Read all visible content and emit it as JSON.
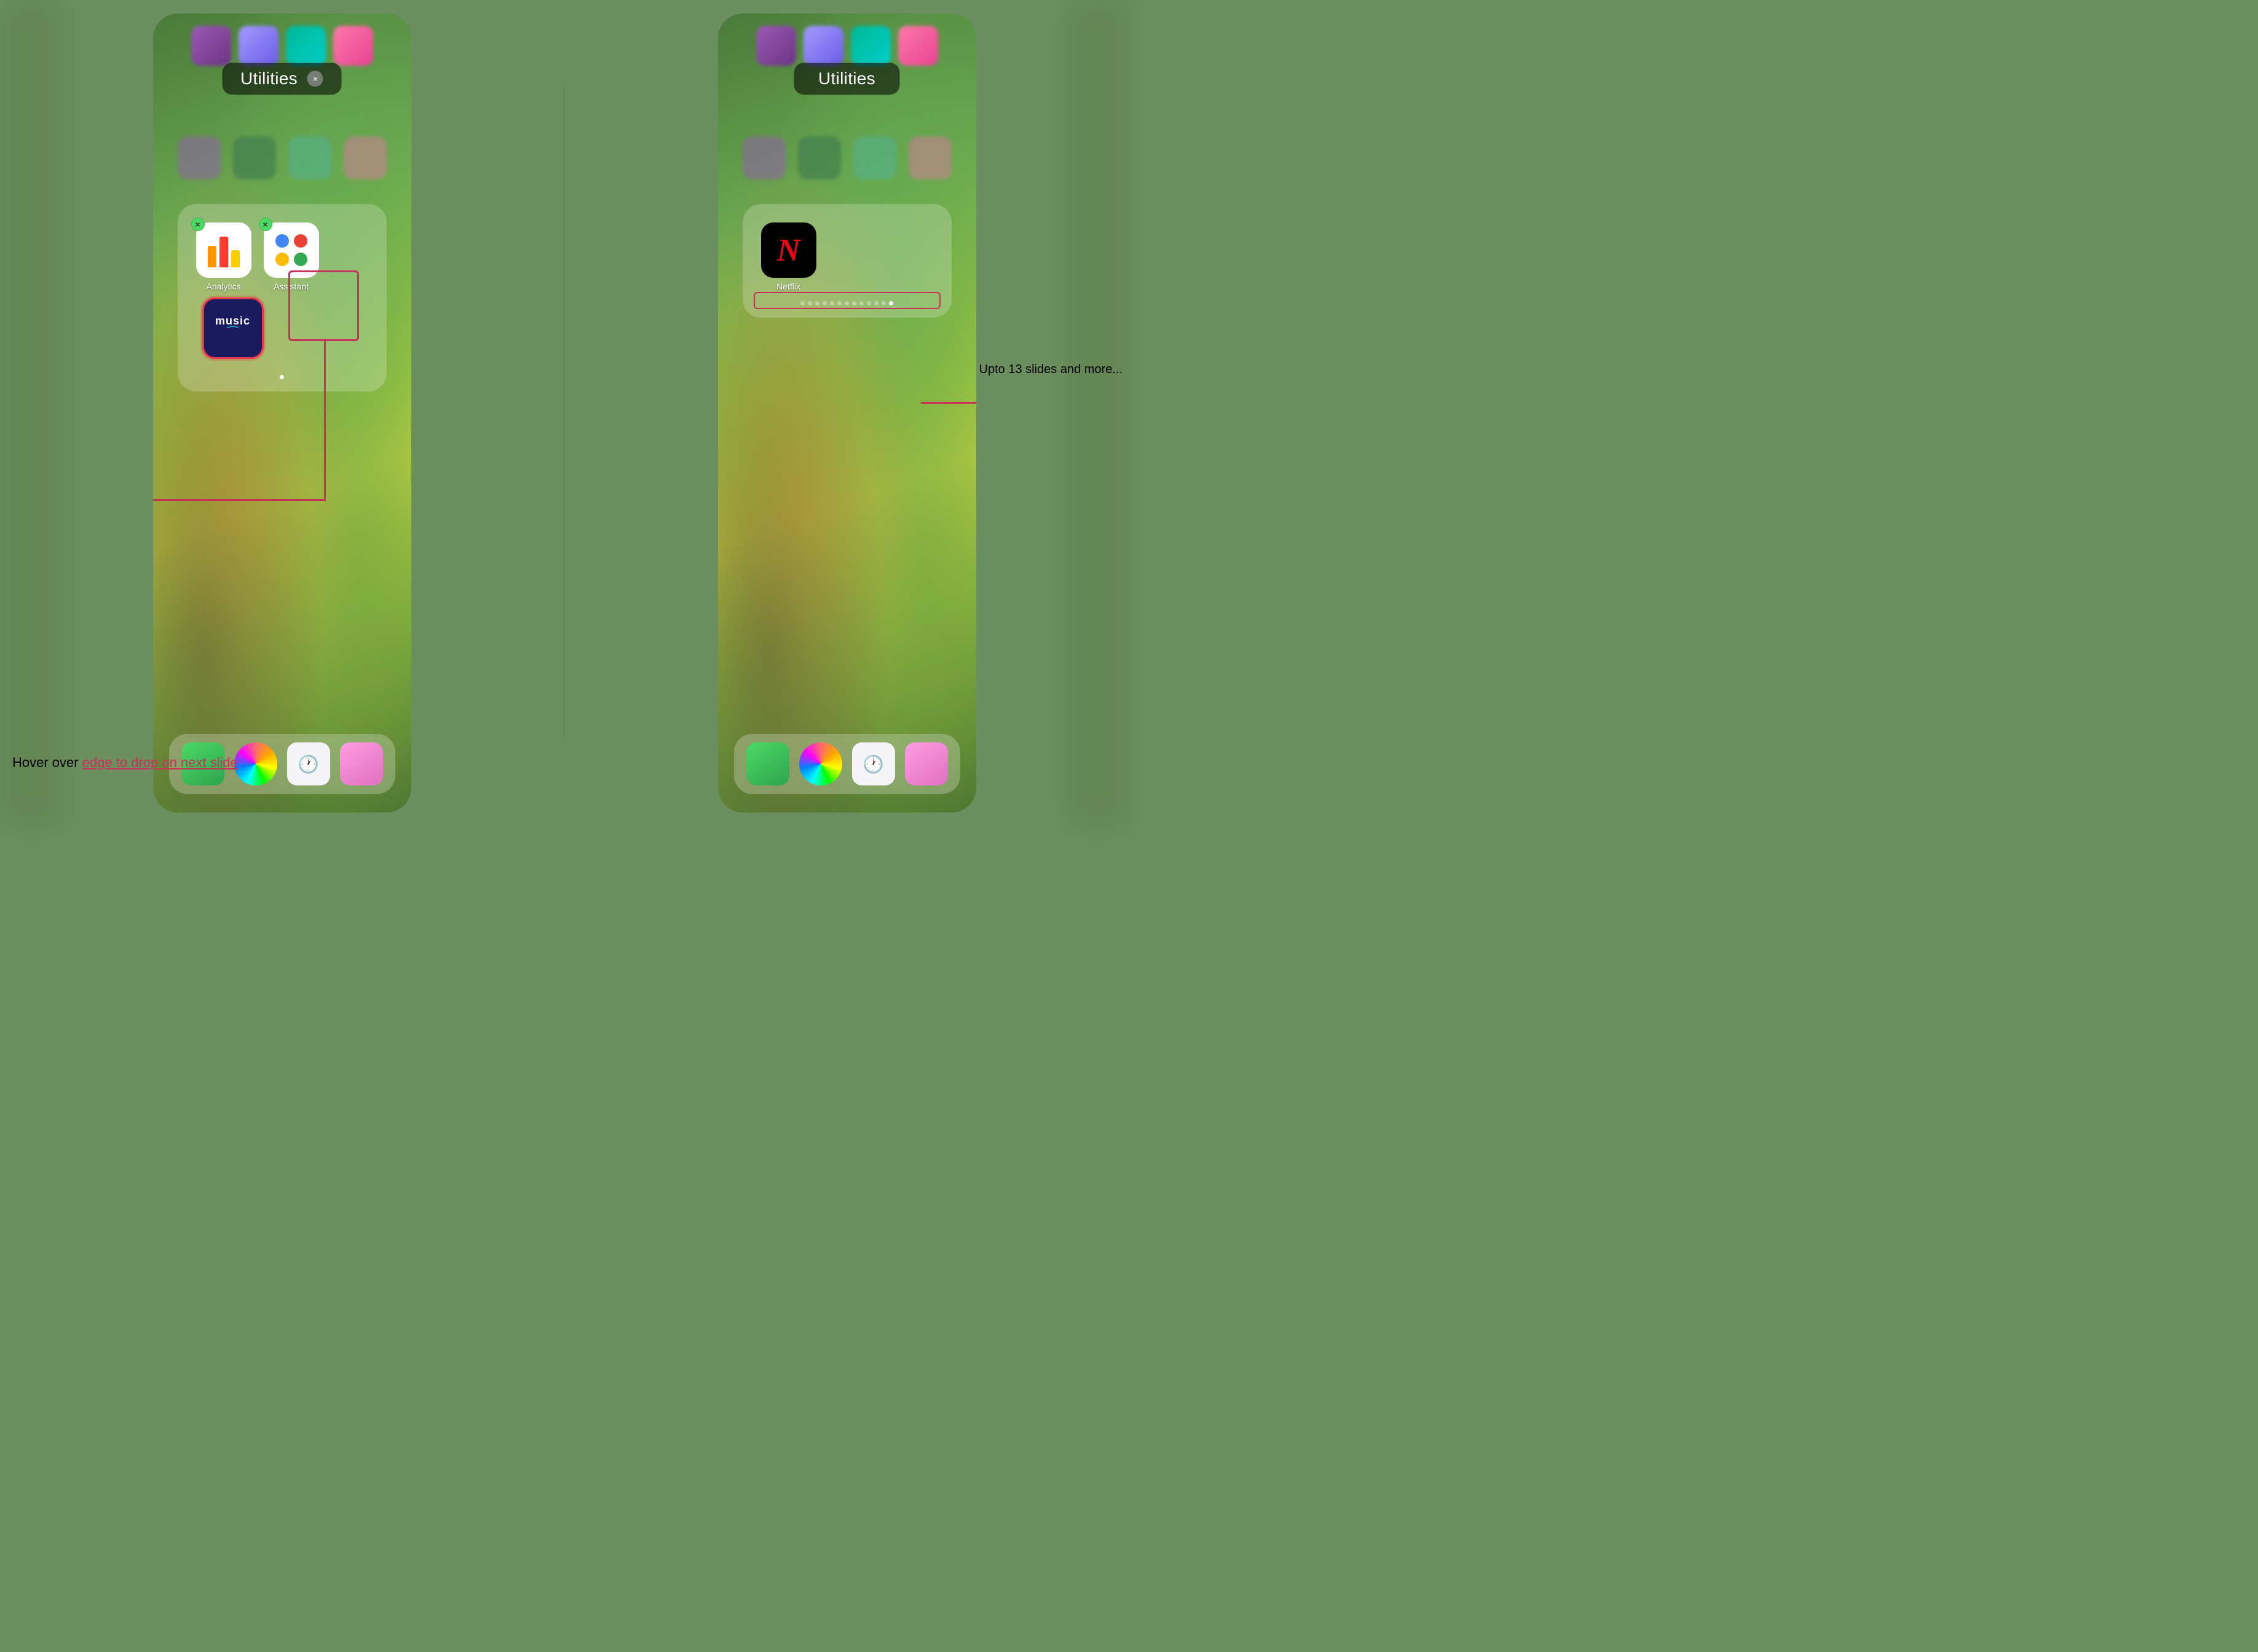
{
  "page": {
    "background_color": "#6b8f5e",
    "divider_color": "rgba(100,100,100,0.3)"
  },
  "left_phone": {
    "utilities_title": "Utilities",
    "close_button_label": "×",
    "folder": {
      "apps": [
        {
          "name": "Analytics",
          "icon_type": "analytics",
          "has_delete": true,
          "delete_color": "green"
        },
        {
          "name": "Assistant",
          "icon_type": "assistant",
          "has_delete": true,
          "delete_color": "green"
        },
        {
          "name": "Amazon Music",
          "icon_type": "music",
          "has_delete": false
        }
      ]
    },
    "annotation": {
      "text_plain": "Hover over ",
      "text_underline": "edge to drop on next slide",
      "combined": "Hover over edge to drop on next slide"
    }
  },
  "right_phone": {
    "utilities_title": "Utilities",
    "folder": {
      "apps": [
        {
          "name": "Netflix",
          "icon_type": "netflix"
        }
      ]
    },
    "page_dots_count": 13,
    "active_dot_index": 12,
    "annotation": {
      "text": "Upto 13 slides and more..."
    }
  },
  "icons": {
    "analytics_bars": [
      {
        "color": "#FF9500",
        "height": 35,
        "label": "orange"
      },
      {
        "color": "#FF3B30",
        "height": 50,
        "label": "red"
      },
      {
        "color": "#FFCC00",
        "height": 28,
        "label": "yellow"
      }
    ],
    "assistant_dots": [
      {
        "color": "#4285F4"
      },
      {
        "color": "#EA4335"
      },
      {
        "color": "#FBBC04"
      },
      {
        "color": "#34A853"
      }
    ],
    "music": {
      "text": "music",
      "bg_color": "#1a1a5e",
      "smile_color": "#00b8d4"
    },
    "netflix": {
      "bg_color": "#000000",
      "letter": "N",
      "letter_color": "#e50914"
    }
  }
}
